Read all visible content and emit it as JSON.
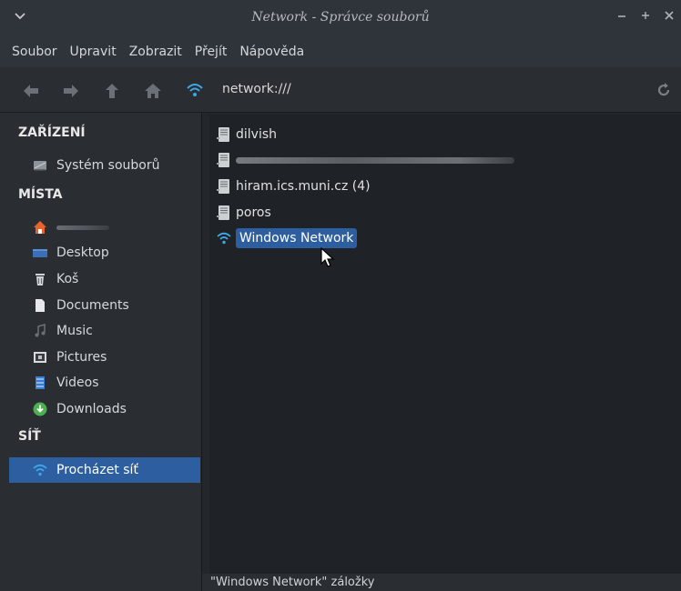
{
  "window": {
    "title": "Network - Správce souborů"
  },
  "menubar": {
    "items": [
      "Soubor",
      "Upravit",
      "Zobrazit",
      "Přejít",
      "Nápověda"
    ]
  },
  "toolbar": {
    "location": "network:///"
  },
  "sidebar": {
    "sections": {
      "devices": "ZAŘÍZENÍ",
      "places": "MÍSTA",
      "network": "SÍŤ"
    },
    "devices": [
      {
        "label": "Systém souborů",
        "icon": "drive-icon"
      }
    ],
    "places": [
      {
        "label": "",
        "icon": "home-icon",
        "redacted": true
      },
      {
        "label": "Desktop",
        "icon": "desktop-icon"
      },
      {
        "label": "Koš",
        "icon": "trash-icon"
      },
      {
        "label": "Documents",
        "icon": "document-icon"
      },
      {
        "label": "Music",
        "icon": "music-icon"
      },
      {
        "label": "Pictures",
        "icon": "pictures-icon"
      },
      {
        "label": "Videos",
        "icon": "videos-icon"
      },
      {
        "label": "Downloads",
        "icon": "downloads-icon"
      }
    ],
    "network": [
      {
        "label": "Procházet síť",
        "icon": "wifi-icon",
        "active": true
      }
    ]
  },
  "files": [
    {
      "name": "dilvish",
      "icon": "server-icon"
    },
    {
      "name": "",
      "icon": "server-icon",
      "redacted": true
    },
    {
      "name": "hiram.ics.muni.cz (4)",
      "icon": "server-icon"
    },
    {
      "name": "poros",
      "icon": "server-icon"
    },
    {
      "name": "Windows Network",
      "icon": "wifi-icon",
      "selected": true
    }
  ],
  "status": {
    "text": "\"Windows Network\" záložky"
  },
  "colors": {
    "accent": "#2d5ea0",
    "wifi": "#3da7e8",
    "home": "#e8642c",
    "downloads": "#4caf50"
  }
}
